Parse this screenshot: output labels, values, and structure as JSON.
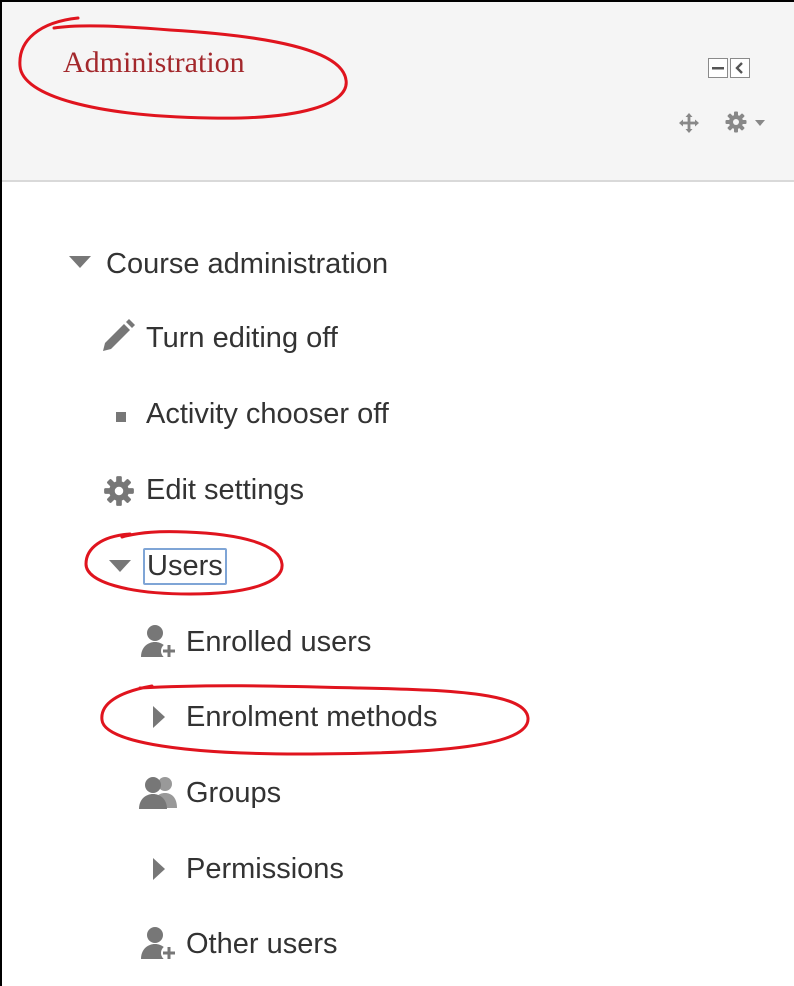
{
  "block": {
    "title": "Administration",
    "controls": {
      "hide_icon": "minimize-icon",
      "dock_icon": "dock-icon",
      "move_icon": "move-icon",
      "settings_icon": "gear-icon",
      "settings_menu_icon": "caret-down-icon"
    }
  },
  "menu": {
    "course_admin": {
      "label": "Course administration",
      "icon": "triangle-down-icon",
      "expanded": true
    },
    "turn_editing": {
      "label": "Turn editing off",
      "icon": "pencil-icon"
    },
    "activity_chooser": {
      "label": "Activity chooser off",
      "icon": "bullet-icon"
    },
    "edit_settings": {
      "label": "Edit settings",
      "icon": "gear-icon"
    },
    "users": {
      "label": "Users",
      "icon": "triangle-down-icon",
      "expanded": true,
      "focused": true
    },
    "enrolled_users": {
      "label": "Enrolled users",
      "icon": "user-add-icon"
    },
    "enrolment_methods": {
      "label": "Enrolment methods",
      "icon": "triangle-right-icon",
      "expanded": false
    },
    "groups": {
      "label": "Groups",
      "icon": "group-icon"
    },
    "permissions": {
      "label": "Permissions",
      "icon": "triangle-right-icon",
      "expanded": false
    },
    "other_users": {
      "label": "Other users",
      "icon": "user-add-icon"
    }
  },
  "colors": {
    "title": "#a3282c",
    "text": "#333333",
    "icon": "#777777",
    "annotation": "#e0141e",
    "focus_outline": "#7fa5d6"
  }
}
